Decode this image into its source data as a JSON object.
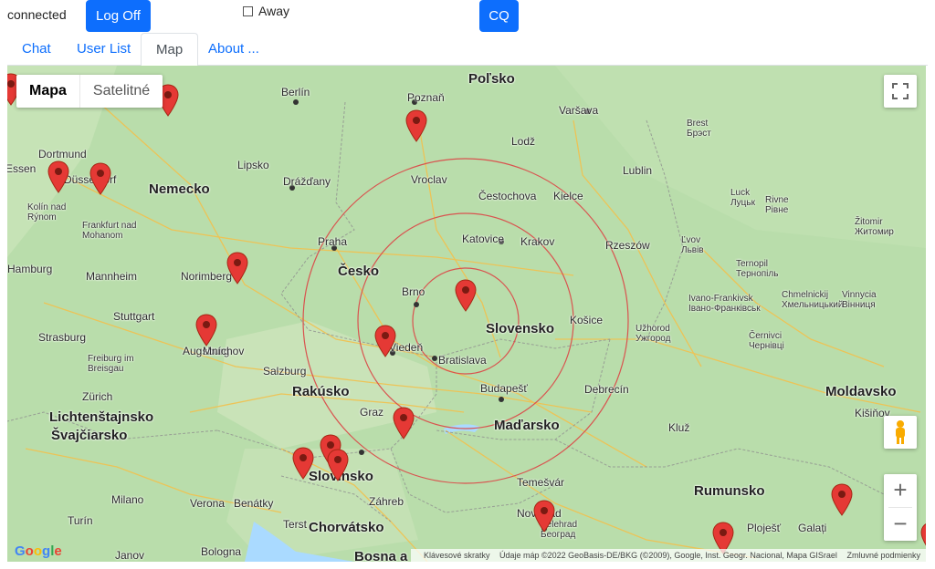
{
  "top": {
    "status": "connected",
    "logoff_label": "Log Off",
    "away_label": "Away",
    "cq_label": "CQ"
  },
  "tabs": [
    {
      "label": "Chat"
    },
    {
      "label": "User List"
    },
    {
      "label": "Map"
    },
    {
      "label": "About ..."
    }
  ],
  "map": {
    "maptype": {
      "map_label": "Mapa",
      "satellite_label": "Satelitné"
    },
    "countries": [
      "Poľsko",
      "Nemecko",
      "Česko",
      "Slovensko",
      "Rakúsko",
      "Maďarsko",
      "Lichtenštajnsko",
      "Švajčiarsko",
      "Slovinsko",
      "Chorvátsko",
      "Rumunsko",
      "Moldavsko",
      "Bosna a"
    ],
    "cities": [
      "Berlín",
      "Poznaň",
      "Varšava",
      "Lodž",
      "Brest\nБрэст",
      "Dortmund",
      "Essen",
      "Düsseldorf",
      "Kolín nad\nRýnom",
      "Lipsko",
      "Drážďany",
      "Vroclav",
      "Lublin",
      "Čestochova",
      "Kielce",
      "Luck\nЛуцьк",
      "Rivne\nРівне",
      "Frankfurt nad\nMohanom",
      "Praha",
      "Katovice",
      "Krakov",
      "Rzeszów",
      "Žitomir\nЖитомир",
      "Ľvov\nЛьвів",
      "Ternopil\nТернопіль",
      "Mannheim",
      "Norimberg",
      "Brno",
      "Stuttgart",
      "Augsburg",
      "Mníchov",
      "Viedeň",
      "Bratislava",
      "Košice",
      "Ivano-Frankivsk\nІвано-Франківськ",
      "Chmelnickij\nХмельницький",
      "Vinnycia\nВінниця",
      "Strasburg",
      "Freiburg im\nBreisgau",
      "Salzburg",
      "Užhorod\nУжгород",
      "Černivci\nЧернівці",
      "Zürich",
      "Graz",
      "Budapešť",
      "Debrecín",
      "Kluž",
      "Kišiňov",
      "Milano",
      "Verona",
      "Benátky",
      "Terst",
      "Záhreb",
      "Temešvár",
      "Turín",
      "Janov",
      "Bologna",
      "Belehrad\nБеоград",
      "Novi Sad",
      "Ploješť",
      "Galați",
      "Hamburg"
    ],
    "attribution": {
      "shortcuts": "Klávesové skratky",
      "data": "Údaje máp ©2022 GeoBasis-DE/BKG (©2009), Google, Inst. Geogr. Nacional, Mapa GISrael",
      "terms": "Zmluvné podmienky"
    },
    "google_logo": "Google",
    "range_rings_color": "#d9534f",
    "marker_color": "#e53935",
    "marker_count": 17
  }
}
